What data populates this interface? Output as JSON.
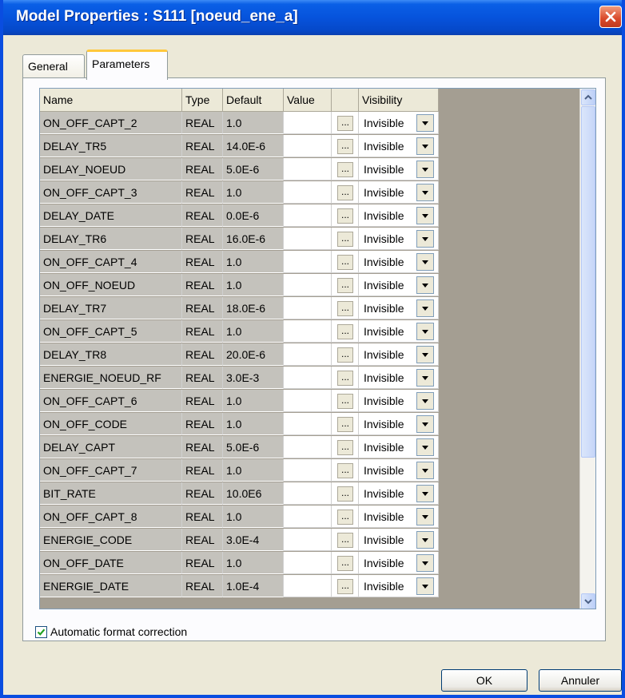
{
  "window": {
    "title": "Model Properties : S111 [noeud_ene_a]"
  },
  "tabs": [
    {
      "label": "General"
    },
    {
      "label": "Parameters"
    }
  ],
  "table": {
    "headers": {
      "name": "Name",
      "type": "Type",
      "default": "Default",
      "value": "Value",
      "visibility": "Visibility"
    },
    "button_label": "...",
    "rows": [
      {
        "name": "ON_OFF_CAPT_2",
        "type": "REAL",
        "default": "1.0",
        "value": "",
        "visibility": "Invisible"
      },
      {
        "name": "DELAY_TR5",
        "type": "REAL",
        "default": "14.0E-6",
        "value": "",
        "visibility": "Invisible"
      },
      {
        "name": "DELAY_NOEUD",
        "type": "REAL",
        "default": "5.0E-6",
        "value": "",
        "visibility": "Invisible"
      },
      {
        "name": "ON_OFF_CAPT_3",
        "type": "REAL",
        "default": "1.0",
        "value": "",
        "visibility": "Invisible"
      },
      {
        "name": "DELAY_DATE",
        "type": "REAL",
        "default": "0.0E-6",
        "value": "",
        "visibility": "Invisible"
      },
      {
        "name": "DELAY_TR6",
        "type": "REAL",
        "default": "16.0E-6",
        "value": "",
        "visibility": "Invisible"
      },
      {
        "name": "ON_OFF_CAPT_4",
        "type": "REAL",
        "default": "1.0",
        "value": "",
        "visibility": "Invisible"
      },
      {
        "name": "ON_OFF_NOEUD",
        "type": "REAL",
        "default": "1.0",
        "value": "",
        "visibility": "Invisible"
      },
      {
        "name": "DELAY_TR7",
        "type": "REAL",
        "default": "18.0E-6",
        "value": "",
        "visibility": "Invisible"
      },
      {
        "name": "ON_OFF_CAPT_5",
        "type": "REAL",
        "default": "1.0",
        "value": "",
        "visibility": "Invisible"
      },
      {
        "name": "DELAY_TR8",
        "type": "REAL",
        "default": "20.0E-6",
        "value": "",
        "visibility": "Invisible"
      },
      {
        "name": "ENERGIE_NOEUD_RF",
        "type": "REAL",
        "default": "3.0E-3",
        "value": "",
        "visibility": "Invisible"
      },
      {
        "name": "ON_OFF_CAPT_6",
        "type": "REAL",
        "default": "1.0",
        "value": "",
        "visibility": "Invisible"
      },
      {
        "name": "ON_OFF_CODE",
        "type": "REAL",
        "default": "1.0",
        "value": "",
        "visibility": "Invisible"
      },
      {
        "name": "DELAY_CAPT",
        "type": "REAL",
        "default": "5.0E-6",
        "value": "",
        "visibility": "Invisible"
      },
      {
        "name": "ON_OFF_CAPT_7",
        "type": "REAL",
        "default": "1.0",
        "value": "",
        "visibility": "Invisible"
      },
      {
        "name": "BIT_RATE",
        "type": "REAL",
        "default": "10.0E6",
        "value": "",
        "visibility": "Invisible"
      },
      {
        "name": "ON_OFF_CAPT_8",
        "type": "REAL",
        "default": "1.0",
        "value": "",
        "visibility": "Invisible"
      },
      {
        "name": "ENERGIE_CODE",
        "type": "REAL",
        "default": "3.0E-4",
        "value": "",
        "visibility": "Invisible"
      },
      {
        "name": "ON_OFF_DATE",
        "type": "REAL",
        "default": "1.0",
        "value": "",
        "visibility": "Invisible"
      },
      {
        "name": "ENERGIE_DATE",
        "type": "REAL",
        "default": "1.0E-4",
        "value": "",
        "visibility": "Invisible"
      }
    ]
  },
  "options": {
    "auto_format_label": "Automatic format correction",
    "auto_format_checked": true
  },
  "buttons": {
    "ok": "OK",
    "cancel": "Annuler"
  },
  "colors": {
    "titlebar": "#0653dc",
    "readonly_cell": "#c4c2bc",
    "grid_background": "#a49e92",
    "active_tab_accent": "#ffc83c"
  },
  "icons": {
    "close": "close-icon",
    "dropdown": "chevron-down-icon",
    "scroll_up": "scroll-up-icon",
    "scroll_down": "scroll-down-icon",
    "check": "checkmark-icon"
  }
}
